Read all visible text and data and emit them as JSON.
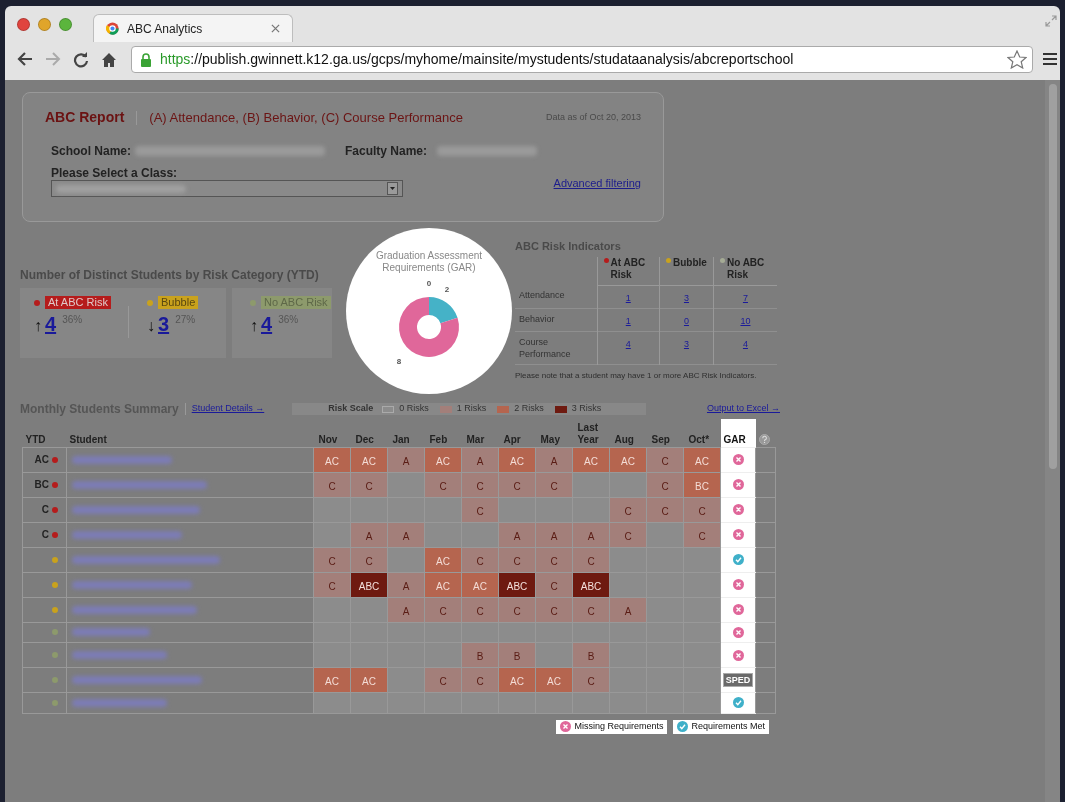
{
  "browser": {
    "tab_title": "ABC Analytics",
    "url_scheme": "https",
    "url_rest": "://publish.gwinnett.k12.ga.us/gcps/myhome/mainsite/mystudents/studataanalysis/abcreportschool"
  },
  "report": {
    "title": "ABC Report",
    "subtitle": "(A) Attendance, (B) Behavior, (C) Course Performance",
    "data_as_of": "Data as of Oct 20, 2013",
    "school_label": "School Name:",
    "faculty_label": "Faculty Name:",
    "class_label": "Please Select a Class:",
    "advanced_link": "Advanced filtering"
  },
  "risk_category": {
    "title": "Number of Distinct Students by Risk Category (YTD)",
    "items": [
      {
        "label": "At ABC Risk",
        "color": "#b51c1c",
        "arrow": "↑",
        "count": "4",
        "percent": "36%"
      },
      {
        "label": "Bubble",
        "color": "#c9a21d",
        "arrow": "↓",
        "count": "3",
        "percent": "27%"
      },
      {
        "label": "No ABC Risk",
        "color": "#8d9a6c",
        "arrow": "↑",
        "count": "4",
        "percent": "36%"
      }
    ]
  },
  "gar": {
    "chart_data": {
      "type": "donut",
      "title": "Graduation Assessment Requirements (GAR)",
      "values": [
        2,
        8,
        0
      ],
      "value_labels": [
        "2",
        "8",
        "0"
      ]
    }
  },
  "risk_indicators": {
    "title": "ABC Risk Indicators",
    "columns": [
      {
        "label": "At ABC Risk",
        "color": "#b51c1c"
      },
      {
        "label": "Bubble",
        "color": "#c9a21d"
      },
      {
        "label": "No ABC Risk",
        "color": "#a5ab95"
      }
    ],
    "rows": [
      {
        "label": "Attendance",
        "values": [
          "1",
          "3",
          "7"
        ]
      },
      {
        "label": "Behavior",
        "values": [
          "1",
          "0",
          "10"
        ]
      },
      {
        "label": "Course Performance",
        "values": [
          "4",
          "3",
          "4"
        ]
      }
    ],
    "note": "Please note that a student may have 1 or more ABC Risk Indicators."
  },
  "summary": {
    "title": "Monthly Students Summary",
    "details_link": "Student Details →",
    "risk_scale_label": "Risk Scale",
    "risk_scale": [
      "0 Risks",
      "1 Risks",
      "2 Risks",
      "3 Risks"
    ],
    "excel_link": "Output to Excel →"
  },
  "table": {
    "columns": [
      "YTD",
      "Student",
      "Nov",
      "Dec",
      "Jan",
      "Feb",
      "Mar",
      "Apr",
      "May",
      "Last Year",
      "Aug",
      "Sep",
      "Oct*",
      "GAR"
    ],
    "rows": [
      {
        "color": "#b51c1c",
        "cells": [
          "AC",
          "",
          "AC",
          "AC",
          "A",
          "AC",
          "A",
          "AC",
          "A",
          "AC",
          "AC",
          "C",
          "AC"
        ],
        "gar": {
          "kind": "missing"
        }
      },
      {
        "color": "#b51c1c",
        "cells": [
          "BC",
          "",
          "C",
          "C",
          "",
          "C",
          "C",
          "C",
          "C",
          "",
          "",
          "C",
          "BC"
        ],
        "gar": {
          "kind": "missing"
        }
      },
      {
        "color": "#b51c1c",
        "cells": [
          "C",
          "",
          "",
          "",
          "",
          "",
          "C",
          "",
          "",
          "",
          "C",
          "C",
          "C"
        ],
        "gar": {
          "kind": "missing"
        }
      },
      {
        "color": "#b51c1c",
        "cells": [
          "C",
          "",
          "",
          "A",
          "A",
          "",
          "",
          "A",
          "A",
          "A",
          "C",
          "",
          "C"
        ],
        "gar": {
          "kind": "missing"
        }
      },
      {
        "color": "#c9a21d",
        "cells": [
          "",
          "",
          "C",
          "C",
          "",
          "AC",
          "C",
          "C",
          "C",
          "C",
          "",
          "",
          ""
        ],
        "gar": {
          "kind": "met"
        }
      },
      {
        "color": "#c9a21d",
        "cells": [
          "",
          "",
          "C",
          "ABC",
          "A",
          "AC",
          "AC",
          "ABC",
          "C",
          "ABC",
          "",
          "",
          ""
        ],
        "gar": {
          "kind": "missing"
        }
      },
      {
        "color": "#c9a21d",
        "cells": [
          "",
          "",
          "",
          "",
          "A",
          "C",
          "C",
          "C",
          "C",
          "C",
          "A",
          "",
          ""
        ],
        "gar": {
          "kind": "missing"
        }
      },
      {
        "color": "#8d9a6c",
        "cells": [
          "",
          "",
          "",
          "",
          "",
          "",
          "",
          "",
          "",
          "",
          "",
          "",
          ""
        ],
        "gar": {
          "kind": "missing"
        }
      },
      {
        "color": "#8d9a6c",
        "cells": [
          "",
          "",
          "",
          "",
          "",
          "",
          "B",
          "B",
          "",
          "B",
          "",
          "",
          ""
        ],
        "gar": {
          "kind": "missing"
        }
      },
      {
        "color": "#8d9a6c",
        "cells": [
          "",
          "",
          "AC",
          "AC",
          "",
          "C",
          "C",
          "AC",
          "AC",
          "C",
          "",
          "",
          ""
        ],
        "gar": {
          "kind": "sped",
          "text": "SPED"
        }
      },
      {
        "color": "#8d9a6c",
        "cells": [
          "",
          "",
          "",
          "",
          "",
          "",
          "",
          "",
          "",
          "",
          "",
          "",
          ""
        ],
        "gar": {
          "kind": "met"
        }
      }
    ]
  },
  "legend": [
    {
      "kind": "missing",
      "label": "Missing Requirements"
    },
    {
      "kind": "met",
      "label": "Requirements Met"
    }
  ]
}
